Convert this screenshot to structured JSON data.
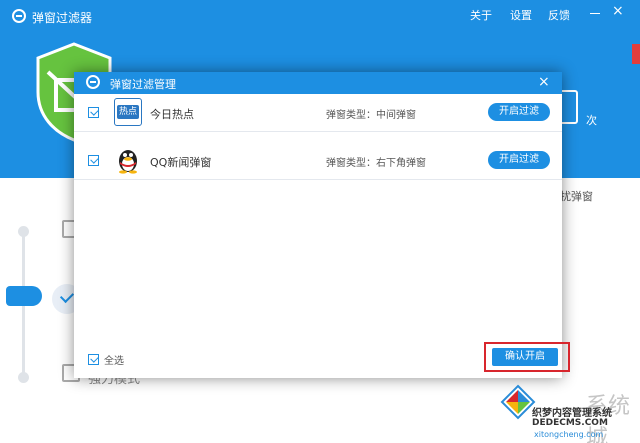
{
  "app": {
    "title": "弹窗过滤器",
    "menu": [
      "关于",
      "设置",
      "反馈"
    ],
    "count_suffix": "次",
    "side_text": "扰弹窗",
    "mode_label": "强力模式"
  },
  "dialog": {
    "title": "弹窗过滤管理",
    "rows": [
      {
        "name": "今日热点",
        "type": "弹窗类型：中间弹窗",
        "button": "开启过滤",
        "logo_text": "热点"
      },
      {
        "name": "QQ新闻弹窗",
        "type": "弹窗类型：右下角弹窗",
        "button": "开启过滤"
      }
    ],
    "select_all": "全选",
    "confirm": "确认开启"
  },
  "watermark": {
    "brand": "系统城",
    "cn_text": "织梦内容管理系统",
    "domain1": "DEDECMS.COM",
    "domain2": "xitongcheng.com"
  },
  "colors": {
    "primary": "#1d8fe2",
    "shield": "#66c33f",
    "highlight": "#d8262d"
  }
}
